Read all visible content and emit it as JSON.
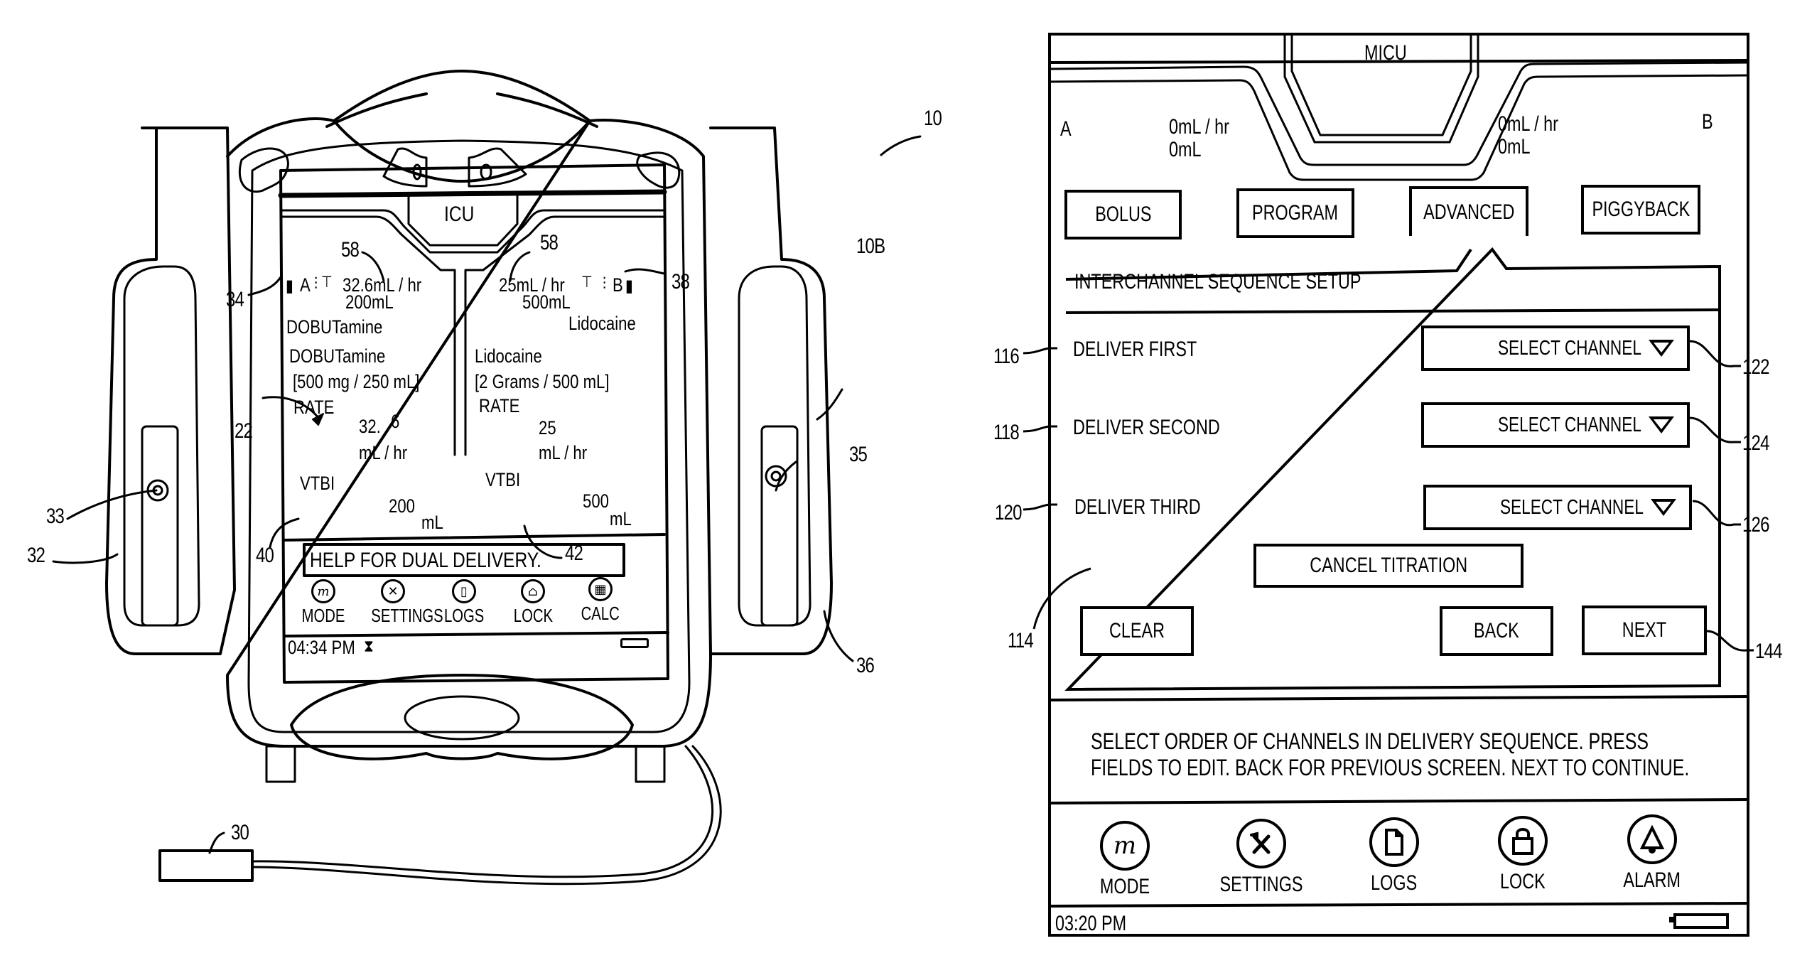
{
  "figure": {
    "left_device": {
      "reference": "10",
      "unit_reference": "10B",
      "screen": {
        "care_area": "ICU",
        "channel_a": {
          "label": "A",
          "header_rate": "32.6mL / hr",
          "header_volume": "200mL",
          "drug_name_short": "DOBUTamine",
          "drug_name": "DOBUTamine",
          "concentration": "[500 mg / 250 mL]",
          "rate_label": "RATE",
          "rate_value_int": "32.",
          "rate_value_dec": "6",
          "rate_unit": "mL / hr",
          "vtbi_label": "VTBI",
          "vtbi_value": "200",
          "vtbi_unit": "mL"
        },
        "channel_b": {
          "label": "B",
          "header_rate": "25mL / hr",
          "header_volume": "500mL",
          "drug_name_short": "Lidocaine",
          "drug_name": "Lidocaine",
          "concentration": "[2 Grams / 500 mL]",
          "rate_label": "RATE",
          "rate_value": "25",
          "rate_unit": "mL / hr",
          "vtbi_label": "VTBI",
          "vtbi_value": "500",
          "vtbi_unit": "mL"
        },
        "help_text": "HELP FOR DUAL DELIVERY.",
        "nav": [
          {
            "label": "MODE",
            "icon": "mode-icon"
          },
          {
            "label": "SETTINGS",
            "icon": "settings-icon"
          },
          {
            "label": "LOGS",
            "icon": "logs-icon"
          },
          {
            "label": "LOCK",
            "icon": "lock-icon"
          },
          {
            "label": "CALC",
            "icon": "calculator-icon"
          }
        ],
        "time": "04:34 PM"
      },
      "refs": {
        "r22": "22",
        "r30": "30",
        "r32": "32",
        "r33": "33",
        "r34": "34",
        "r35": "35",
        "r36": "36",
        "r38": "38",
        "r40": "40",
        "r42": "42",
        "r58a": "58",
        "r58b": "58"
      }
    },
    "right_screen": {
      "care_area": "MICU",
      "channel_a": {
        "label": "A",
        "rate": "0mL / hr",
        "volume": "0mL"
      },
      "channel_b": {
        "label": "B",
        "rate": "0mL / hr",
        "volume": "0mL"
      },
      "tabs": [
        {
          "label": "BOLUS"
        },
        {
          "label": "PROGRAM"
        },
        {
          "label": "ADVANCED",
          "active": true
        },
        {
          "label": "PIGGYBACK"
        }
      ],
      "panel_title": "INTERCHANNEL SEQUENCE SETUP",
      "rows": [
        {
          "label": "DELIVER FIRST",
          "select_value": "SELECT CHANNEL",
          "label_ref": "116",
          "select_ref": "122"
        },
        {
          "label": "DELIVER SECOND",
          "select_value": "SELECT CHANNEL",
          "label_ref": "118",
          "select_ref": "124"
        },
        {
          "label": "DELIVER THIRD",
          "select_value": "SELECT CHANNEL",
          "label_ref": "120",
          "select_ref": "126"
        }
      ],
      "cancel_titration": "CANCEL TITRATION",
      "clear": "CLEAR",
      "back": "BACK",
      "next": "NEXT",
      "panel_ref": "114",
      "next_ref": "144",
      "help_line1": "SELECT ORDER OF CHANNELS IN DELIVERY SEQUENCE. PRESS",
      "help_line2": "FIELDS TO EDIT. BACK FOR PREVIOUS SCREEN. NEXT TO CONTINUE.",
      "nav": [
        {
          "label": "MODE",
          "icon": "mode-icon"
        },
        {
          "label": "SETTINGS",
          "icon": "settings-icon"
        },
        {
          "label": "LOGS",
          "icon": "logs-icon"
        },
        {
          "label": "LOCK",
          "icon": "lock-icon"
        },
        {
          "label": "ALARM",
          "icon": "alarm-bell-icon"
        }
      ],
      "time": "03:20 PM"
    }
  }
}
